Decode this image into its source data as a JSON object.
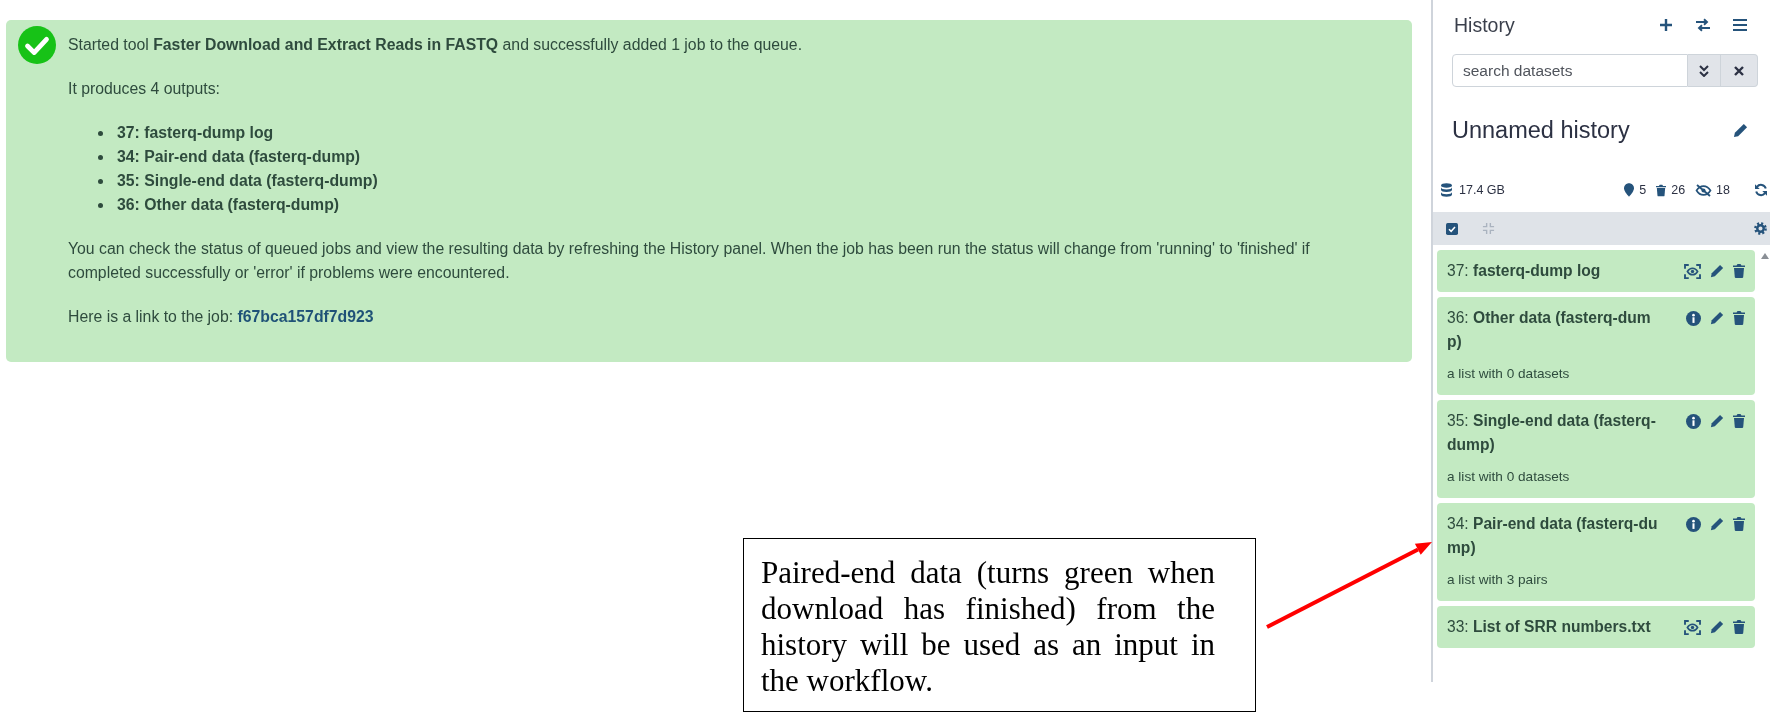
{
  "alert": {
    "message": "Started tool **Faster Download and Extract Reads in FASTQ** and successfully added 1 job to the queue.",
    "outputs_intro": "It produces 4 outputs:",
    "outputs": [
      "37: fasterq-dump log",
      "34: Pair-end data (fasterq-dump)",
      "35: Single-end data (fasterq-dump)",
      "36: Other data (fasterq-dump)"
    ],
    "info": "You can check the status of queued jobs and view the resulting data by refreshing the History panel. When the job has been run the status will change from 'running' to 'finished' if completed successfully or 'error' if problems were encountered.",
    "link_prefix": "Here is a link to the job:",
    "job_id": "f67bca157df7d923"
  },
  "history": {
    "title": "History",
    "search": {
      "placeholder": "search datasets"
    },
    "name": "Unnamed history",
    "size": "17.4 GB",
    "counts": [
      {
        "kind": "active",
        "value": "5"
      },
      {
        "kind": "deleted",
        "value": "26"
      },
      {
        "kind": "hidden",
        "value": "18"
      }
    ],
    "items": [
      {
        "kind": "dataset",
        "title": "37: **fasterq-dump log**"
      },
      {
        "kind": "collection",
        "title": "36: **Other data (fasterq-dump)**",
        "description": "a list with 0 datasets"
      },
      {
        "kind": "collection",
        "title": "35: **Single-end data (fasterq-dump)**",
        "description": "a list with 0 datasets"
      },
      {
        "kind": "collection",
        "title": "34: **Pair-end data (fasterq-dump)**",
        "description": "a list with 3 pairs"
      },
      {
        "kind": "dataset",
        "title": "33: **List of SRR numbers.txt**"
      }
    ]
  },
  "annotation": {
    "text": "Paired-end data (turns green when download has finished) from the history will be used as an input in the workflow."
  }
}
